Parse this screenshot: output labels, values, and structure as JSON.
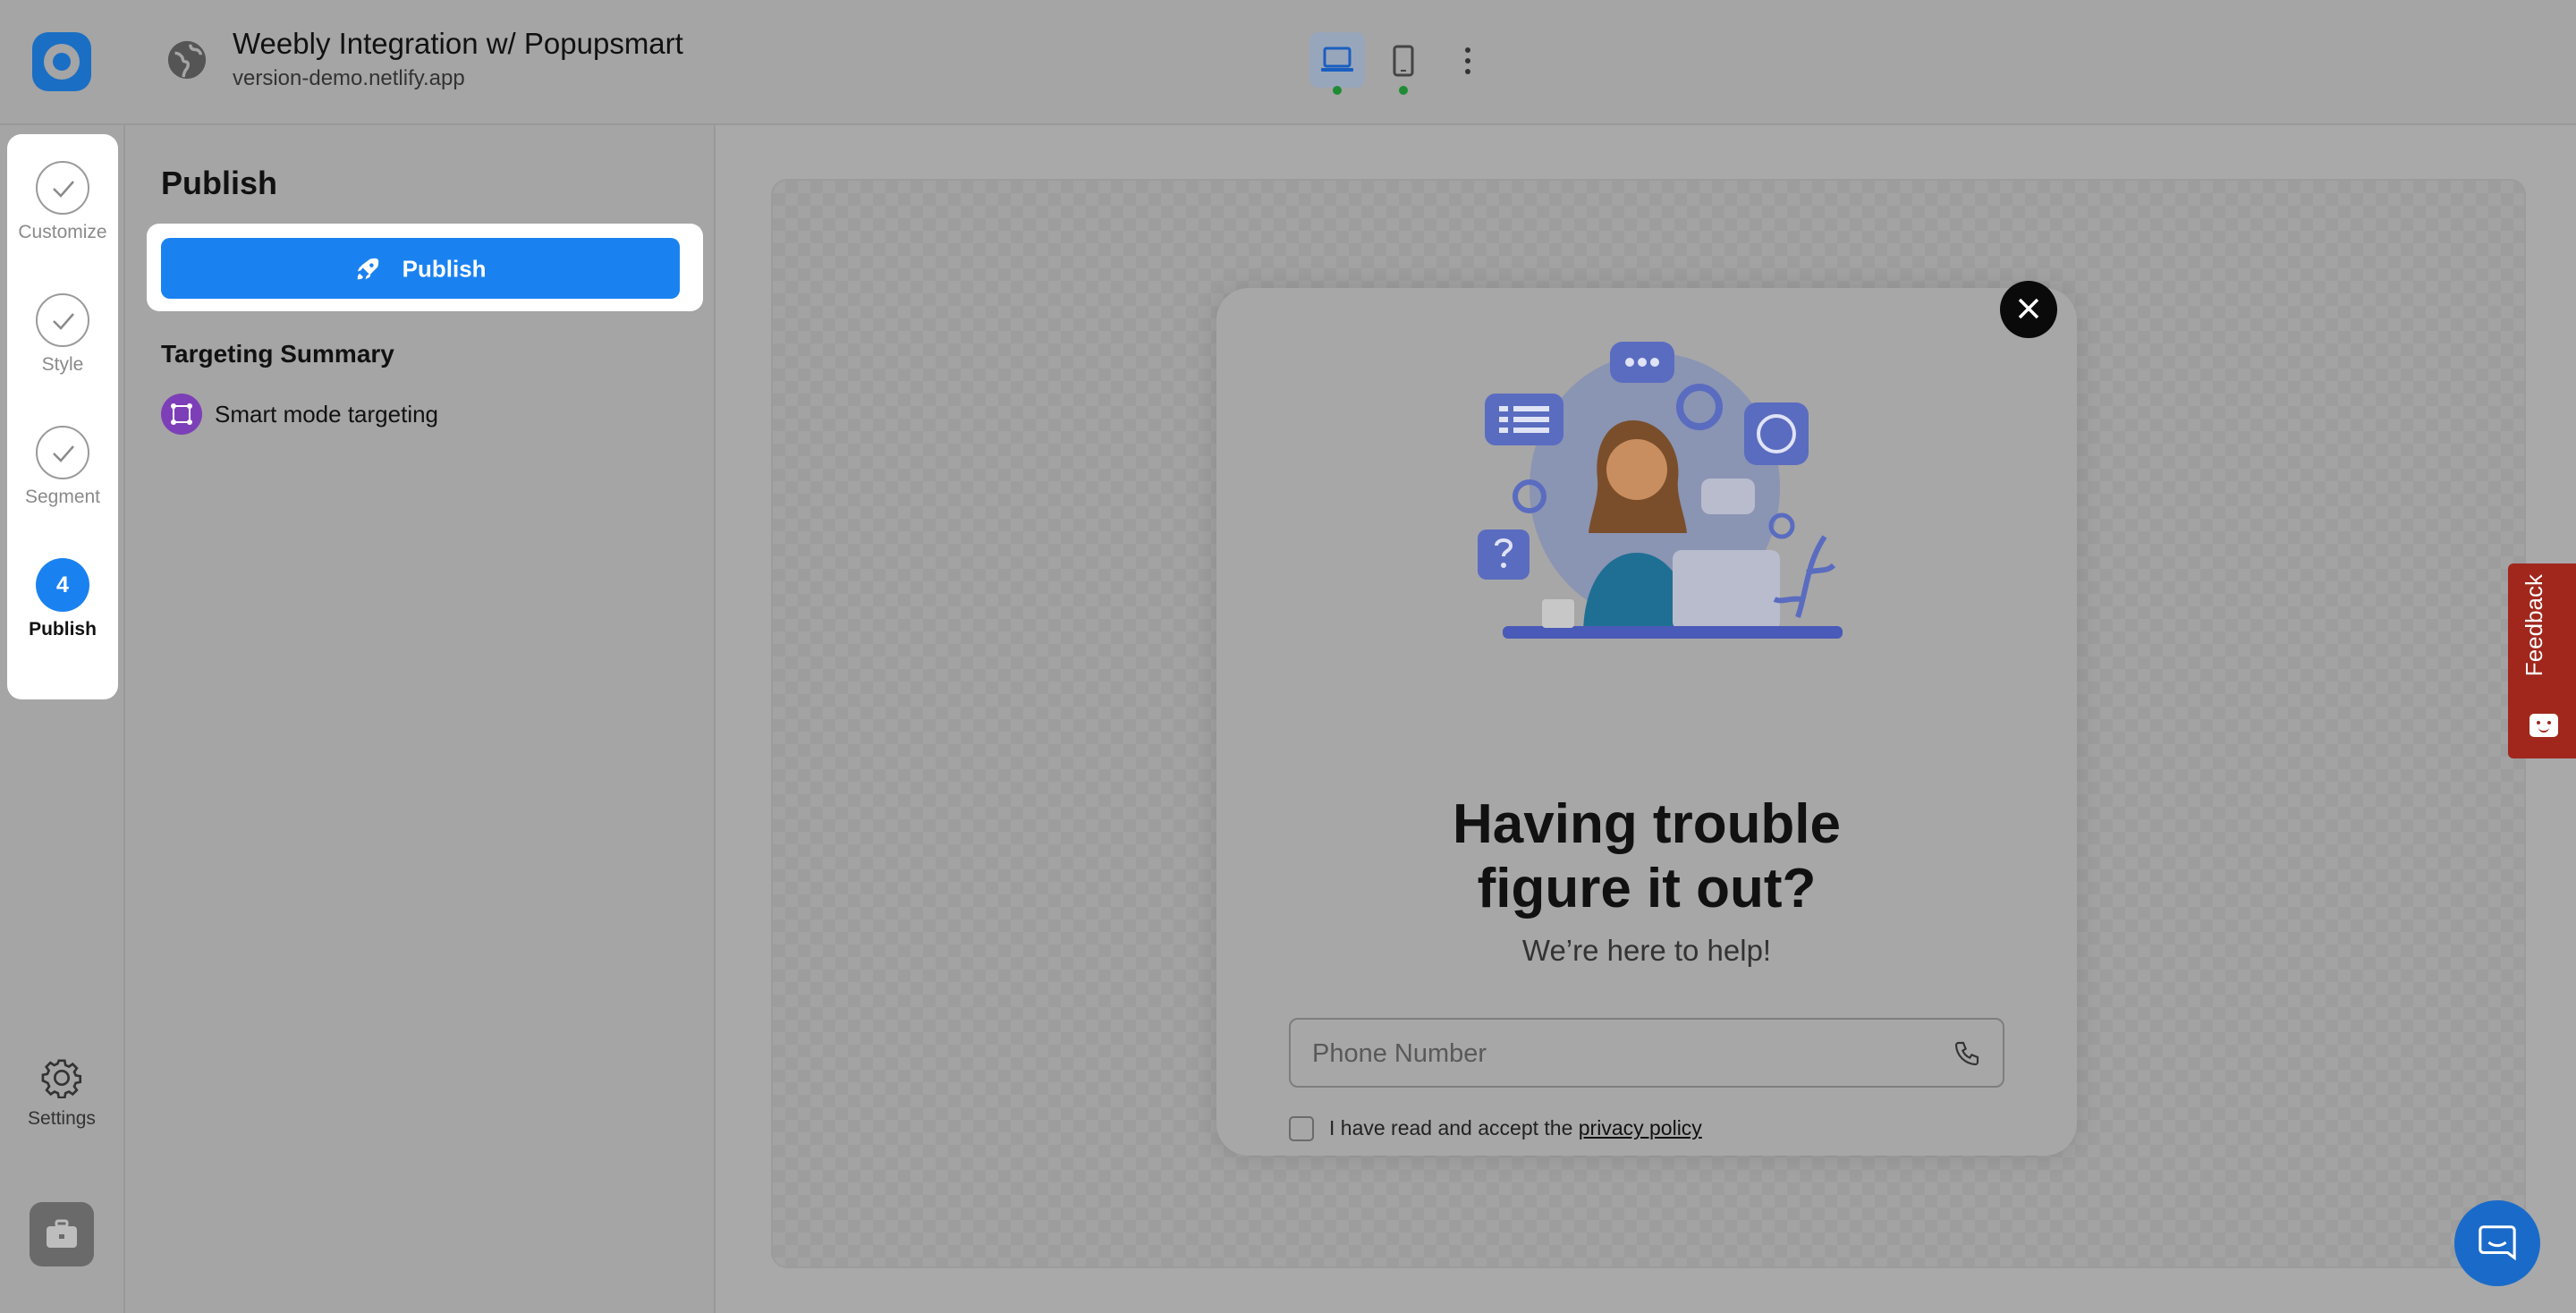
{
  "header": {
    "site_title": "Weebly Integration w/ Popupsmart",
    "site_url": "version-demo.netlify.app"
  },
  "steps": [
    {
      "label": "Customize",
      "state": "done"
    },
    {
      "label": "Style",
      "state": "done"
    },
    {
      "label": "Segment",
      "state": "done"
    },
    {
      "label": "Publish",
      "state": "active",
      "number": "4"
    }
  ],
  "rail": {
    "settings_label": "Settings"
  },
  "panel": {
    "title": "Publish",
    "publish_button": "Publish",
    "targeting_title": "Targeting Summary",
    "targeting_item": "Smart mode targeting"
  },
  "popup": {
    "headline_line1": "Having trouble",
    "headline_line2": "figure it out?",
    "subheadline": "We’re here to help!",
    "phone_placeholder": "Phone Number",
    "consent_text": "I have read and accept the ",
    "consent_link": "privacy policy"
  },
  "feedback": {
    "label": "Feedback"
  },
  "colors": {
    "accent": "#1a82f0",
    "feedback": "#a1271d",
    "targeting_icon": "#7d3fb8",
    "status_dot": "#1e8c34"
  }
}
